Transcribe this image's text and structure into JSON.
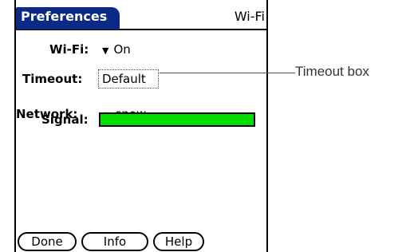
{
  "titlebar": {
    "title": "Preferences",
    "panel": "Wi-Fi"
  },
  "fields": {
    "wifi": {
      "label": "Wi-Fi:",
      "value": "On"
    },
    "timeout": {
      "label": "Timeout:",
      "value": "Default"
    },
    "network": {
      "label": "Network:",
      "value": "snow"
    },
    "signal": {
      "label": "Signal:",
      "level": 1.0,
      "color": "#00e000"
    }
  },
  "callout": {
    "text": "Timeout box"
  },
  "buttons": {
    "done": "Done",
    "info": "Info",
    "help": "Help"
  },
  "icons": {
    "dropdown": "triangle-down-icon"
  }
}
